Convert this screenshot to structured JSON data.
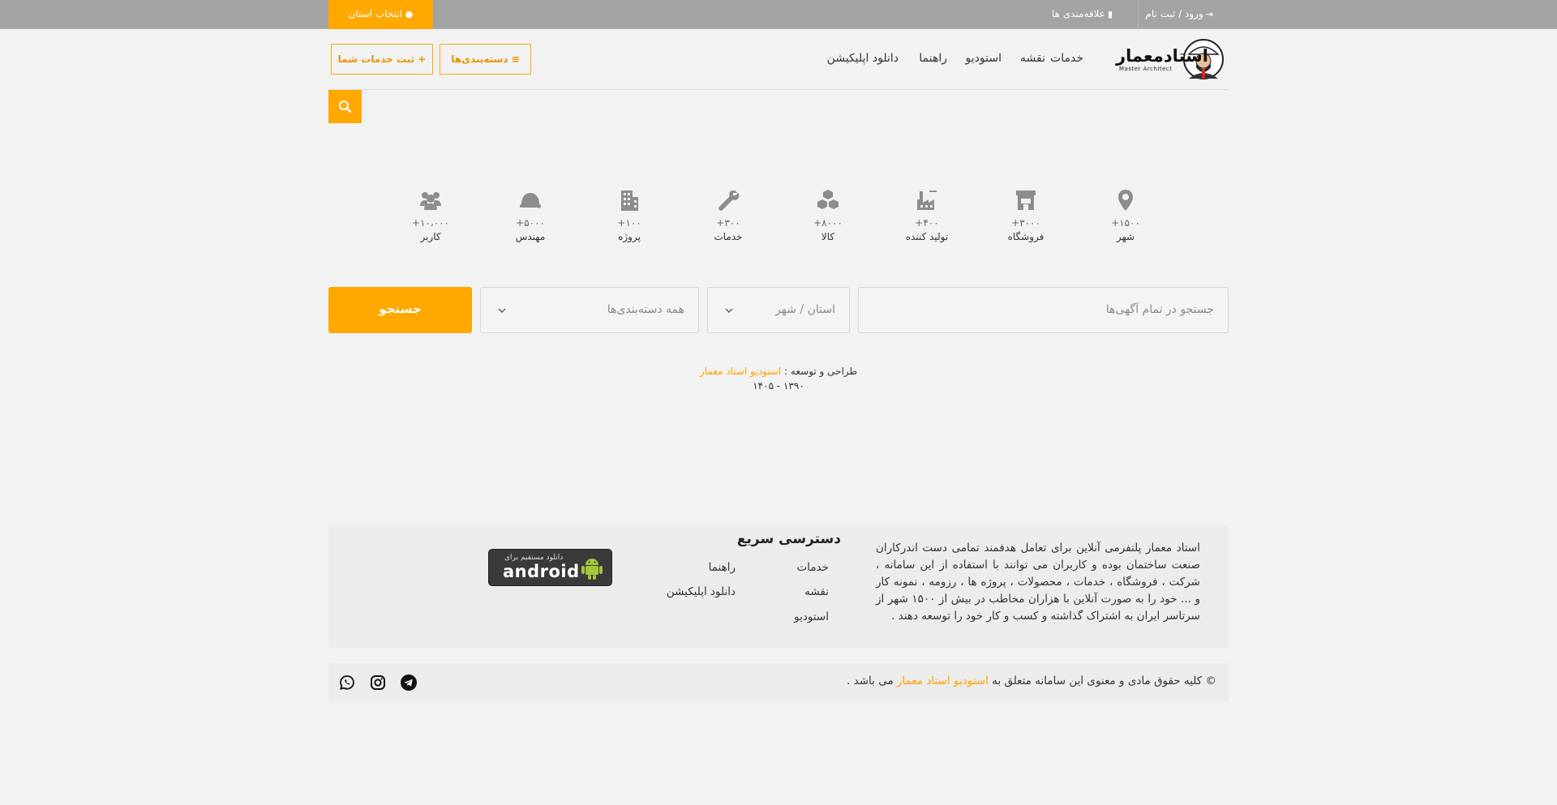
{
  "topbar": {
    "login_label": "ورود / ثبت نام",
    "favorites_label": "علاقه‌مندی ها",
    "province_label": "انتخاب استان"
  },
  "nav": {
    "items": [
      "خدمات",
      "نقشه",
      "استودیو",
      "راهنما",
      "دانلود اپلیکیشن"
    ],
    "categories_label": "دسته‌بندی‌ها",
    "register_label": "ثبت خدمات شما"
  },
  "logo": {
    "name": "استادمعمار",
    "subtitle": "Master Architect"
  },
  "stats": [
    {
      "icon": "map-pin-icon",
      "num": "+۱۵۰۰",
      "label": "شهر"
    },
    {
      "icon": "store-icon",
      "num": "+۳۰۰۰",
      "label": "فروشگاه"
    },
    {
      "icon": "factory-icon",
      "num": "+۴۰۰",
      "label": "تولید کننده"
    },
    {
      "icon": "cubes-icon",
      "num": "+۸۰۰۰",
      "label": "کالا"
    },
    {
      "icon": "wrench-icon",
      "num": "+۳۰۰",
      "label": "خدمات"
    },
    {
      "icon": "building-icon",
      "num": "+۱۰۰",
      "label": "پروژه"
    },
    {
      "icon": "hard-hat-icon",
      "num": "+۵۰۰۰",
      "label": "مهندس"
    },
    {
      "icon": "users-icon",
      "num": "+۱۰،۰۰۰",
      "label": "کاربر"
    }
  ],
  "search": {
    "placeholder": "جستجو در تمام آگهی‌ها",
    "city_placeholder": "استان / شهر",
    "category_placeholder": "همه دسته‌بندی‌ها",
    "button_label": "جستجو"
  },
  "credit": {
    "prefix": "طراحی و توسعه : ",
    "studio": "استودیو استاد معمار",
    "years": "۱۳۹۰ - ۱۴۰۵"
  },
  "footer": {
    "about": "استاد معمار پلتفرمی آنلاین برای تعامل هدفمند تمامی دست اندرکاران صنعت ساختمان بوده و کاربران می توانند با استفاده از این سامانه ، شرکت ، فروشگاه ، خدمات ، محصولات ، پروژه ها ، رزومه ، نمونه کار و ... خود را به صورت آنلاین با هزاران مخاطب در بیش از ۱۵۰۰ شهر از سرتاسر ایران به اشتراک گذاشته و کسب و کار خود را توسعه دهند .",
    "quick_title": "دسترسی سریع",
    "quick_col1": [
      "خدمات",
      "نقشه",
      "استودیو"
    ],
    "quick_col2": [
      "راهنما",
      "دانلود اپلیکیشن"
    ],
    "android_small": "دانلود مستقیم برای",
    "android_big": "android",
    "copyright_prefix": "© کلیه حقوق مادی و معنوی این سامانه متعلق به ",
    "copyright_link": "استودیو استاد معمار",
    "copyright_suffix": " می باشد ."
  },
  "colors": {
    "accent": "#ffa900",
    "topbar": "#a3a3a3",
    "background": "#f2f2f2"
  }
}
